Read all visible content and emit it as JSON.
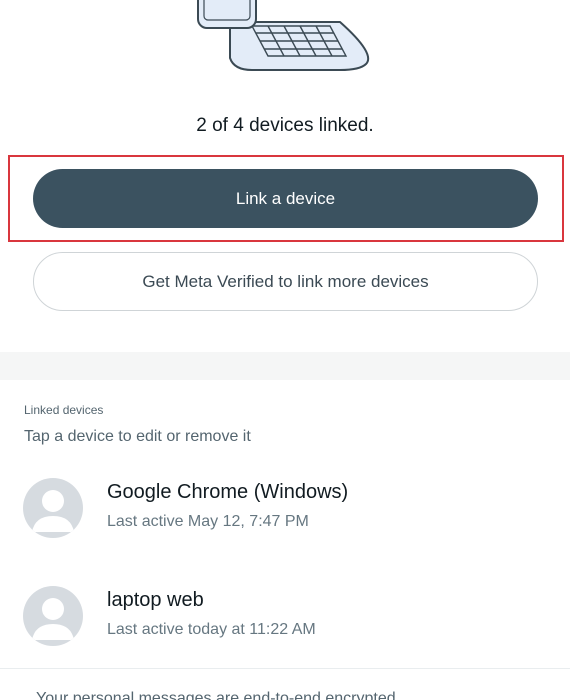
{
  "status": {
    "linked_text": "2 of 4 devices linked."
  },
  "buttons": {
    "link_device": "Link a device",
    "get_verified": "Get Meta Verified to link more devices"
  },
  "linked_devices": {
    "title": "Linked devices",
    "hint": "Tap a device to edit or remove it",
    "items": [
      {
        "name": "Google Chrome (Windows)",
        "last_active": "Last active May 12, 7:47 PM"
      },
      {
        "name": "laptop web",
        "last_active": "Last active today at 11:22 AM"
      }
    ]
  },
  "footer": {
    "text": "Your personal messages are end-to-end encrypted"
  },
  "colors": {
    "primary_button": "#3b5260",
    "highlight_border": "#d9363e",
    "avatar_bg": "#d6dbe0"
  },
  "icons": {
    "illustration": "laptop-phone-illustration",
    "avatar": "default-avatar-icon"
  }
}
